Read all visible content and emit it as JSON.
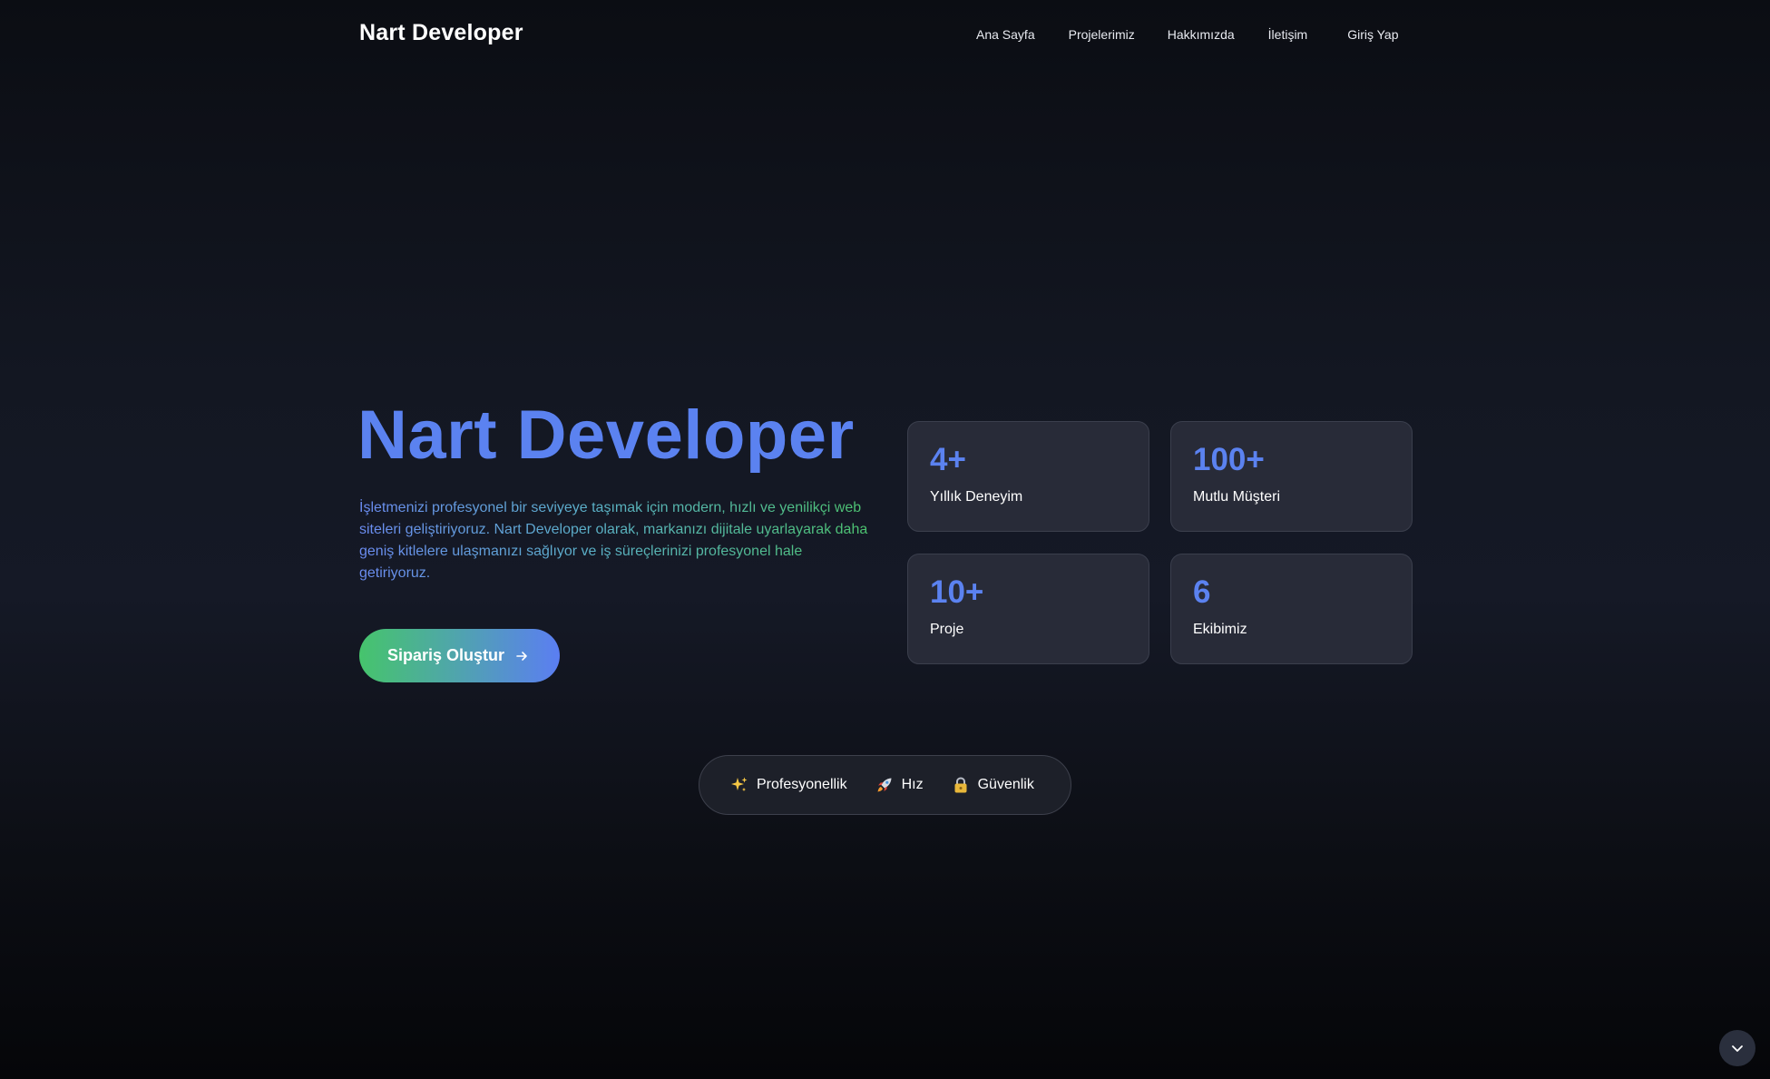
{
  "header": {
    "brand": "Nart Developer",
    "nav": [
      {
        "label": "Ana Sayfa"
      },
      {
        "label": "Projelerimiz"
      },
      {
        "label": "Hakkımızda"
      },
      {
        "label": "İletişim"
      },
      {
        "label": "Giriş Yap"
      }
    ]
  },
  "hero": {
    "title": "Nart Developer",
    "description": "İşletmenizi profesyonel bir seviyeye taşımak için modern, hızlı ve yenilikçi web siteleri geliştiriyoruz. Nart Developer olarak, markanızı dijitale uyarlayarak daha geniş kitlelere ulaşmanızı sağlıyor ve iş süreçlerinizi profesyonel hale getiriyoruz.",
    "cta_label": "Sipariş Oluştur",
    "cta_icon": "arrow-right-icon"
  },
  "stats": [
    {
      "value": "4+",
      "label": "Yıllık Deneyim"
    },
    {
      "value": "100+",
      "label": "Mutlu Müşteri"
    },
    {
      "value": "10+",
      "label": "Proje"
    },
    {
      "value": "6",
      "label": "Ekibimiz"
    }
  ],
  "features": [
    {
      "icon": "sparkles-icon",
      "label": "Profesyonellik"
    },
    {
      "icon": "rocket-icon",
      "label": "Hız"
    },
    {
      "icon": "lock-icon",
      "label": "Güvenlik"
    }
  ],
  "scroll_button": {
    "icon": "chevron-down-icon"
  },
  "colors": {
    "accent_blue": "#5b82f0",
    "accent_green": "#46c46c",
    "card_bg": "#282b38",
    "page_bg": "#131722"
  }
}
